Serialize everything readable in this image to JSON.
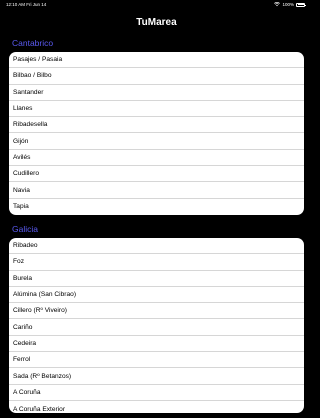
{
  "status_bar": {
    "time": "12:10 AM",
    "date": "Fri Jun 14",
    "battery_percent": "100%",
    "battery_level": 1.0
  },
  "nav": {
    "title": "TuMarea"
  },
  "sections": [
    {
      "header": "Cantabrico",
      "items": [
        "Pasajes / Pasaia",
        "Bilbao / Bilbo",
        "Santander",
        "Llanes",
        "Ribadesella",
        "Gijón",
        "Avilés",
        "Cudillero",
        "Navia",
        "Tapia"
      ]
    },
    {
      "header": "Galicia",
      "items": [
        "Ribadeo",
        "Foz",
        "Burela",
        "Alúmina (San Cibrao)",
        "Cillero (Rº Viveiro)",
        "Cariño",
        "Cedeira",
        "Ferrol",
        "Sada (Rº Betanzos)",
        "A Coruña",
        "A Coruña Exterior"
      ]
    }
  ]
}
